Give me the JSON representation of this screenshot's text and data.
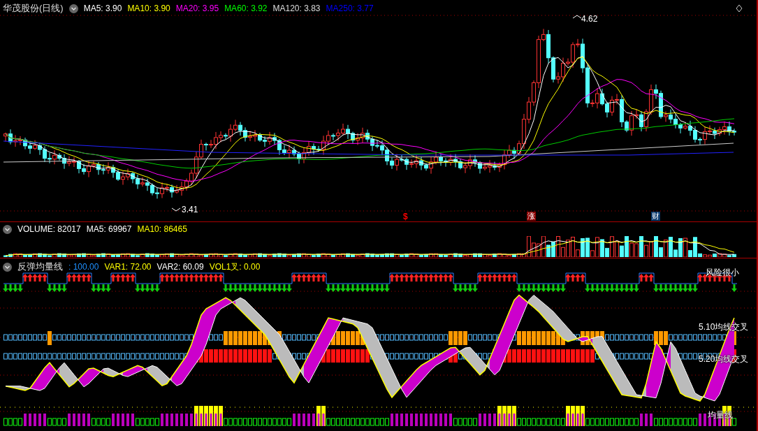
{
  "price_panel": {
    "title": "华茂股份(日线)",
    "indicators": [
      {
        "label": "MA5: 3.90",
        "color": "#ffffff"
      },
      {
        "label": "MA10: 3.90",
        "color": "#ffff00"
      },
      {
        "label": "MA20: 3.95",
        "color": "#ff00ff"
      },
      {
        "label": "MA60: 3.92",
        "color": "#00ff00"
      },
      {
        "label": "MA120: 3.83",
        "color": "#dddddd"
      },
      {
        "label": "MA250: 3.77",
        "color": "#0000ff"
      }
    ],
    "high_label": "4.62",
    "low_label": "3.41",
    "event_marks": [
      {
        "kind": "symbol",
        "text": "$",
        "color": "#ff0000"
      },
      {
        "kind": "box",
        "text": "涨",
        "color": "#8b0000"
      },
      {
        "kind": "box",
        "text": "财",
        "color": "#0b3a6e"
      }
    ]
  },
  "volume_panel": {
    "indicators": [
      {
        "label": "VOLUME: 82017",
        "color": "#ffffff"
      },
      {
        "label": "MA5: 69967",
        "color": "#ffffff"
      },
      {
        "label": "MA10: 86465",
        "color": "#ffff00"
      }
    ]
  },
  "signal_panel": {
    "title": "反弹均量线",
    "indicators": [
      {
        "label": ": 100.00",
        "color": "#1e90ff"
      },
      {
        "label": "VAR1: 72.00",
        "color": "#ffff00"
      },
      {
        "label": "VAR2: 60.09",
        "color": "#ffffff"
      },
      {
        "label": "VOL1叉: 0.00",
        "color": "#ffff00"
      }
    ],
    "labels": [
      "风险很小",
      "5.10均线交叉",
      "5.20均线交叉",
      "均量线"
    ]
  }
}
